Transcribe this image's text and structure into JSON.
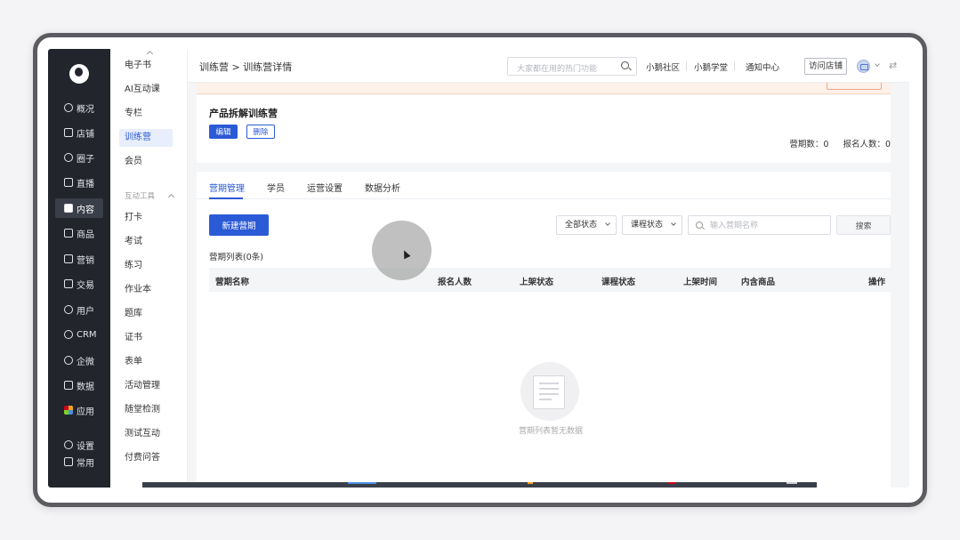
{
  "nav": {
    "items": [
      "概况",
      "店铺",
      "圈子",
      "直播",
      "内容",
      "商品",
      "营销",
      "交易",
      "用户",
      "CRM",
      "企微",
      "数据",
      "应用"
    ],
    "bottom": [
      "设置",
      "常用"
    ]
  },
  "sub_sidebar": {
    "items": [
      "电子书",
      "AI互动课",
      "专栏",
      "训练营",
      "会员"
    ],
    "group_label": "互动工具",
    "group_items": [
      "打卡",
      "考试",
      "练习",
      "作业本",
      "题库",
      "证书",
      "表单",
      "活动管理",
      "随堂检测",
      "测试互动",
      "付费问答"
    ]
  },
  "topbar": {
    "breadcrumb": "训练营 > 训练营详情",
    "search_placeholder": "大家都在用的热门功能",
    "links": [
      "小鹅社区",
      "小鹅学堂",
      "通知中心"
    ],
    "visit_store": "访问店铺"
  },
  "detail": {
    "title": "产品拆解训练营",
    "edit": "编辑",
    "delete": "删除",
    "period_count": "营期数：0",
    "enroll_count": "报名人数：0"
  },
  "tabs": [
    "营期管理",
    "学员",
    "运营设置",
    "数据分析"
  ],
  "toolbar": {
    "new_period": "新建营期",
    "status_select": "全部状态",
    "course_select": "课程状态",
    "name_placeholder": "输入营期名称",
    "search": "搜索"
  },
  "list": {
    "title": "营期列表(0条)",
    "columns": [
      "营期名称",
      "报名人数",
      "上架状态",
      "课程状态",
      "上架时间",
      "内含商品",
      "操作"
    ],
    "empty_text": "营期列表暂无数据"
  },
  "colors": {
    "accent": "#2b5ad6",
    "nav_bg": "#22252c"
  }
}
